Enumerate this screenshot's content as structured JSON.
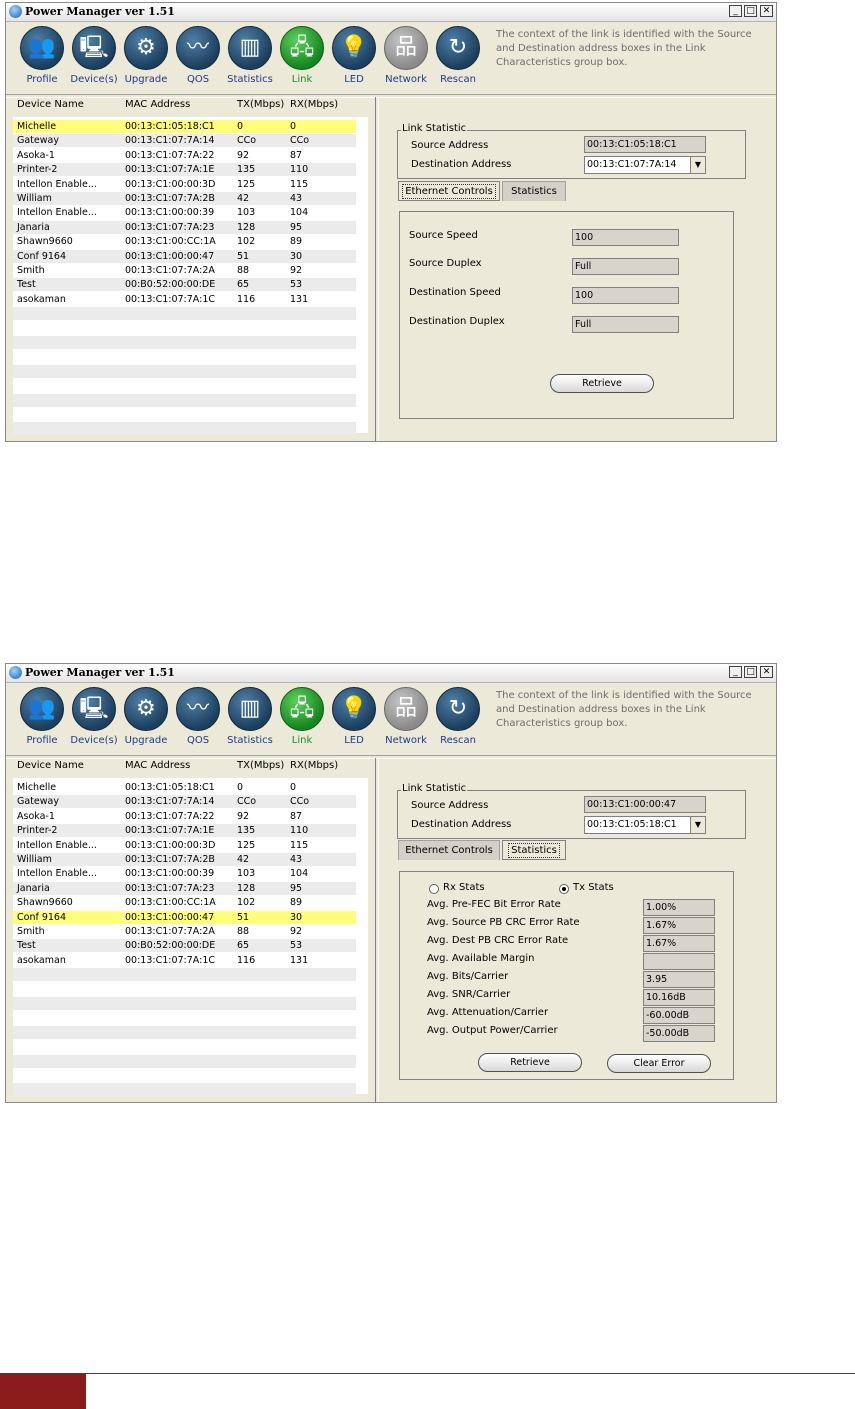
{
  "window_title": "Power Manager ver 1.51",
  "window_buttons": {
    "min": "_",
    "max": "□",
    "close": "✕"
  },
  "toolbar": {
    "items": [
      {
        "label": "Profile",
        "icon": "profile-icon",
        "glyph": "👥"
      },
      {
        "label": "Device(s)",
        "icon": "devices-icon",
        "glyph": "🖳"
      },
      {
        "label": "Upgrade",
        "icon": "upgrade-icon",
        "glyph": "⚙"
      },
      {
        "label": "QOS",
        "icon": "qos-icon",
        "glyph": "〰"
      },
      {
        "label": "Statistics",
        "icon": "statistics-icon",
        "glyph": "▥"
      },
      {
        "label": "Link",
        "icon": "link-icon",
        "glyph": "🖧"
      },
      {
        "label": "LED",
        "icon": "led-icon",
        "glyph": "💡"
      },
      {
        "label": "Network",
        "icon": "network-icon",
        "glyph": "品"
      },
      {
        "label": "Rescan",
        "icon": "rescan-icon",
        "glyph": "↻"
      }
    ],
    "info_text": "The context of the link is identified with the Source and Destination address boxes in the Link Characteristics group box."
  },
  "device_list": {
    "headers": [
      "Device Name",
      "MAC Address",
      "TX(Mbps)",
      "RX(Mbps)"
    ],
    "rows": [
      [
        "Michelle",
        "00:13:C1:05:18:C1",
        "0",
        "0"
      ],
      [
        "Gateway",
        "00:13:C1:07:7A:14",
        "CCo",
        "CCo"
      ],
      [
        "Asoka-1",
        "00:13:C1:07:7A:22",
        "92",
        "87"
      ],
      [
        "Printer-2",
        "00:13:C1:07:7A:1E",
        "135",
        "110"
      ],
      [
        "Intellon Enable...",
        "00:13:C1:00:00:3D",
        "125",
        "115"
      ],
      [
        "William",
        "00:13:C1:07:7A:2B",
        "42",
        "43"
      ],
      [
        "Intellon Enable...",
        "00:13:C1:00:00:39",
        "103",
        "104"
      ],
      [
        "Janaria",
        "00:13:C1:07:7A:23",
        "128",
        "95"
      ],
      [
        "Shawn9660",
        "00:13:C1:00:CC:1A",
        "102",
        "89"
      ],
      [
        "Conf 9164",
        "00:13:C1:00:00:47",
        "51",
        "30"
      ],
      [
        "Smith",
        "00:13:C1:07:7A:2A",
        "88",
        "92"
      ],
      [
        "Test",
        "00:B0:52:00:00:DE",
        "65",
        "53"
      ],
      [
        "asokaman",
        "00:13:C1:07:7A:1C",
        "116",
        "131"
      ]
    ]
  },
  "link_statistic": {
    "group_title": "Link Statistic",
    "source_label": "Source Address",
    "destination_label": "Destination Address"
  },
  "screen1": {
    "selected_row": 0,
    "source_address": "00:13:C1:05:18:C1",
    "destination_address": "00:13:C1:07:7A:14",
    "tabs": [
      "Ethernet Controls",
      "Statistics"
    ],
    "active_tab": 0,
    "ethernet": [
      {
        "label": "Source Speed",
        "value": "100"
      },
      {
        "label": "Source Duplex",
        "value": "Full"
      },
      {
        "label": "Destination Speed",
        "value": "100"
      },
      {
        "label": "Destination Duplex",
        "value": "Full"
      }
    ],
    "retrieve_label": "Retrieve"
  },
  "screen2": {
    "selected_row": 9,
    "source_address": "00:13:C1:00:00:47",
    "destination_address": "00:13:C1:05:18:C1",
    "tabs": [
      "Ethernet Controls",
      "Statistics"
    ],
    "active_tab": 1,
    "radio_rx": "Rx Stats",
    "radio_tx": "Tx Stats",
    "radio_selected": "tx",
    "stats": [
      {
        "label": "Avg. Pre-FEC Bit Error Rate",
        "value": "1.00%"
      },
      {
        "label": "Avg. Source PB CRC Error Rate",
        "value": "1.67%"
      },
      {
        "label": "Avg. Dest PB CRC Error Rate",
        "value": "1.67%"
      },
      {
        "label": "Avg. Available Margin",
        "value": ""
      },
      {
        "label": "Avg. Bits/Carrier",
        "value": "3.95"
      },
      {
        "label": "Avg. SNR/Carrier",
        "value": "10.16dB"
      },
      {
        "label": "Avg. Attenuation/Carrier",
        "value": "-60.00dB"
      },
      {
        "label": "Avg. Output Power/Carrier",
        "value": "-50.00dB"
      }
    ],
    "retrieve_label": "Retrieve",
    "clear_error_label": "Clear Error"
  }
}
